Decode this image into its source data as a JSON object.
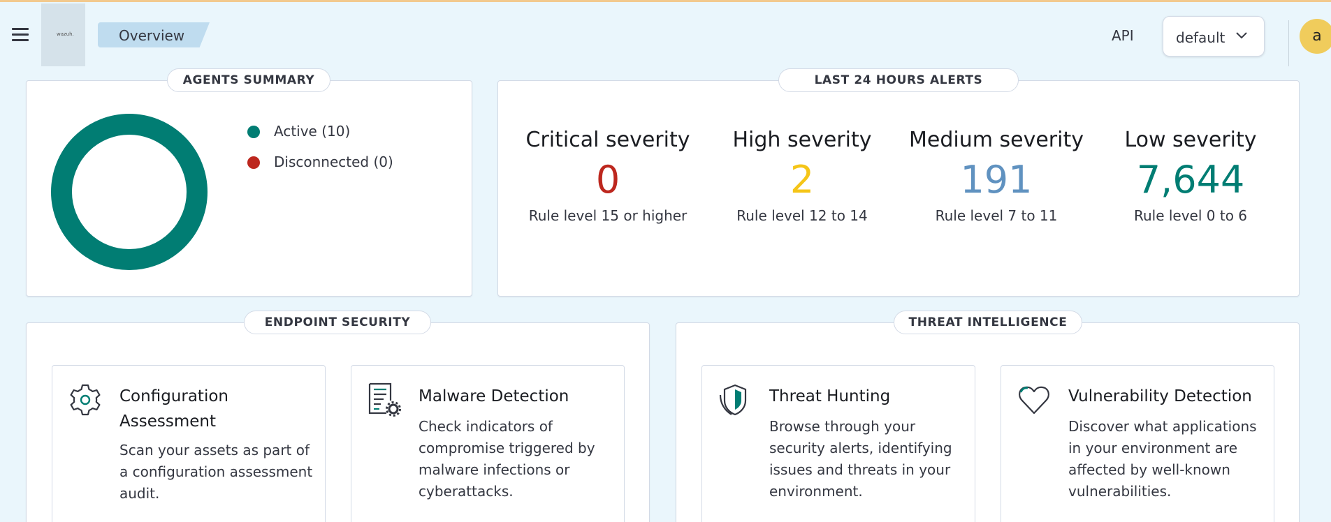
{
  "header": {
    "menu_icon": "hamburger-menu-icon",
    "logo_text": "wazuh.",
    "breadcrumb": "Overview",
    "api_label": "API",
    "api_select_value": "default",
    "avatar_letter": "a"
  },
  "agents_summary": {
    "title": "AGENTS SUMMARY",
    "legend": [
      {
        "label": "Active (10)",
        "color": "#017d73"
      },
      {
        "label": "Disconnected (0)",
        "color": "#bd271e"
      }
    ],
    "donut": {
      "active": 10,
      "disconnected": 0,
      "color": "#017d73"
    }
  },
  "alerts": {
    "title": "LAST 24 HOURS ALERTS",
    "items": [
      {
        "title": "Critical severity",
        "value": "0",
        "sub": "Rule level 15 or higher",
        "color": "#bd271e"
      },
      {
        "title": "High severity",
        "value": "2",
        "sub": "Rule level 12 to 14",
        "color": "#f5c518"
      },
      {
        "title": "Medium severity",
        "value": "191",
        "sub": "Rule level 7 to 11",
        "color": "#6092c0"
      },
      {
        "title": "Low severity",
        "value": "7,644",
        "sub": "Rule level 0 to 6",
        "color": "#017d73"
      }
    ]
  },
  "endpoint_security": {
    "title": "ENDPOINT SECURITY",
    "cards": [
      {
        "title": "Configuration Assessment",
        "desc": "Scan your assets as part of a configuration assessment audit.",
        "icon": "gear-icon"
      },
      {
        "title": "Malware Detection",
        "desc": "Check indicators of compromise triggered by malware infections or cyberattacks.",
        "icon": "document-gear-icon"
      }
    ]
  },
  "threat_intelligence": {
    "title": "THREAT INTELLIGENCE",
    "cards": [
      {
        "title": "Threat Hunting",
        "desc": "Browse through your security alerts, identifying issues and threats in your environment.",
        "icon": "shield-icon"
      },
      {
        "title": "Vulnerability Detection",
        "desc": "Discover what applications in your environment are affected by well-known vulnerabilities.",
        "icon": "heart-icon"
      }
    ]
  }
}
